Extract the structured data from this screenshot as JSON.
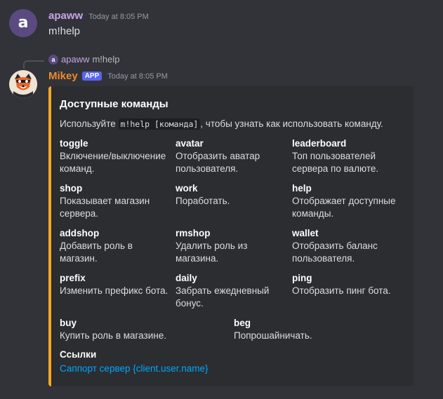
{
  "message1": {
    "avatar_letter": "a",
    "username": "apaww",
    "timestamp": "Today at 8:05 PM",
    "content": "m!help"
  },
  "reply": {
    "avatar_letter": "a",
    "username": "apaww",
    "content": "m!help"
  },
  "message2": {
    "username": "Mikey",
    "badge": "APP",
    "timestamp": "Today at 8:05 PM",
    "accent_color": "#f5a623"
  },
  "embed": {
    "title": "Доступные команды",
    "desc_before": "Используйте ",
    "desc_code": "m!help [команда]",
    "desc_after": ", чтобы узнать как использовать команду.",
    "fields": [
      {
        "name": "toggle",
        "value": "Включение/выключение команд."
      },
      {
        "name": "avatar",
        "value": "Отобразить аватар пользователя."
      },
      {
        "name": "leaderboard",
        "value": "Топ пользователей сервера по валюте."
      },
      {
        "name": "shop",
        "value": "Показывает магазин сервера."
      },
      {
        "name": "work",
        "value": "Поработать."
      },
      {
        "name": "help",
        "value": "Отображает доступные команды."
      },
      {
        "name": "addshop",
        "value": "Добавить роль в магазин."
      },
      {
        "name": "rmshop",
        "value": "Удалить роль из магазина."
      },
      {
        "name": "wallet",
        "value": "Отобразить баланс пользователя."
      },
      {
        "name": "prefix",
        "value": "Изменить префикс бота."
      },
      {
        "name": "daily",
        "value": "Забрать ежедневный бонус."
      },
      {
        "name": "ping",
        "value": "Отобразить пинг бота."
      },
      {
        "name": "buy",
        "value": "Купить роль в магазине."
      },
      {
        "name": "beg",
        "value": "Попрошайничать."
      }
    ],
    "links_title": "Ссылки",
    "links_value": "Саппорт сервер {client.user.name}"
  }
}
